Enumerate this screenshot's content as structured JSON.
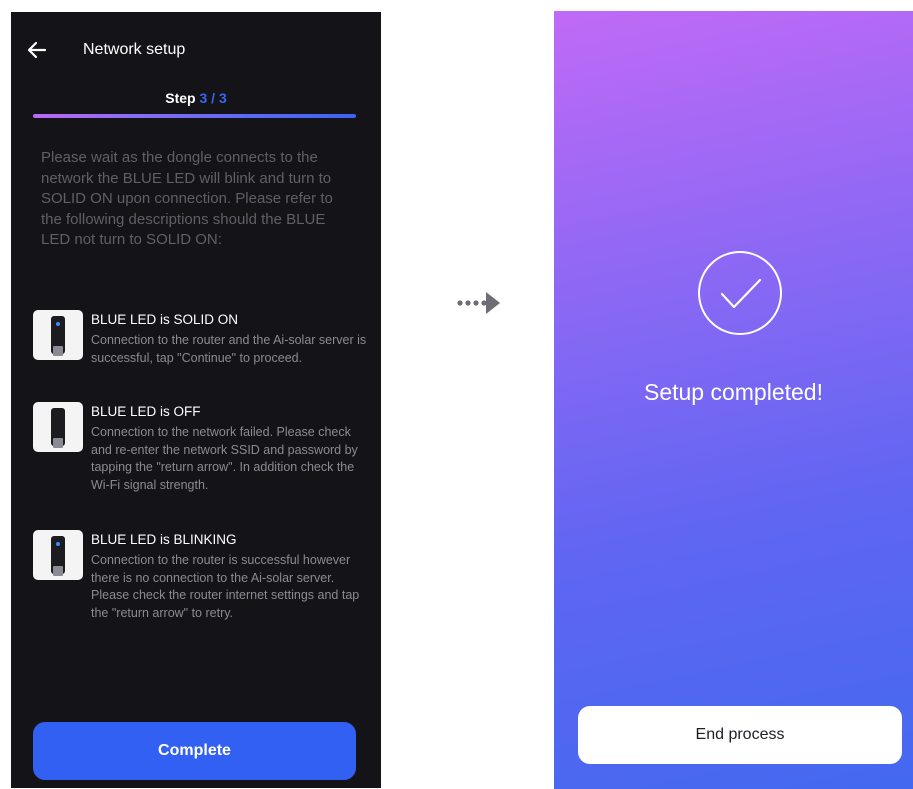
{
  "setup_screen": {
    "header": {
      "title": "Network setup"
    },
    "step": {
      "label": "Step",
      "current": "3",
      "separator": " / ",
      "total": "3"
    },
    "progress": {
      "value": 1.0
    },
    "intro": "Please wait as the dongle connects to the network the BLUE LED will blink and turn to SOLID ON upon connection. Please refer to the following descriptions should the BLUE LED not turn to SOLID ON:",
    "led_states": [
      {
        "title": "BLUE LED is SOLID ON",
        "description": "Connection to the router and the Ai-solar server is successful, tap \"Continue\" to proceed."
      },
      {
        "title": "BLUE LED is OFF",
        "description": "Connection to the network failed. Please check and re-enter the network SSID and password by tapping the \"return arrow\". In addition check the Wi-Fi signal strength."
      },
      {
        "title": "BLUE LED is BLINKING",
        "description": "Connection to the router is successful however there is no connection to the Ai-solar server. Please check the router internet settings and tap the \"return arrow\" to retry."
      }
    ],
    "complete_button": "Complete"
  },
  "completed_screen": {
    "title": "Setup completed!",
    "end_button": "End process"
  },
  "colors": {
    "dark_background": "#141418",
    "accent_blue": "#3160f2",
    "gradient_top": "#c06af6",
    "gradient_bottom": "#4468f0"
  },
  "icons": {
    "back": "arrow-left-icon",
    "flow": "dotted-arrow-right-icon",
    "success": "check-circle-icon",
    "dongle": "dongle-device-icon"
  }
}
